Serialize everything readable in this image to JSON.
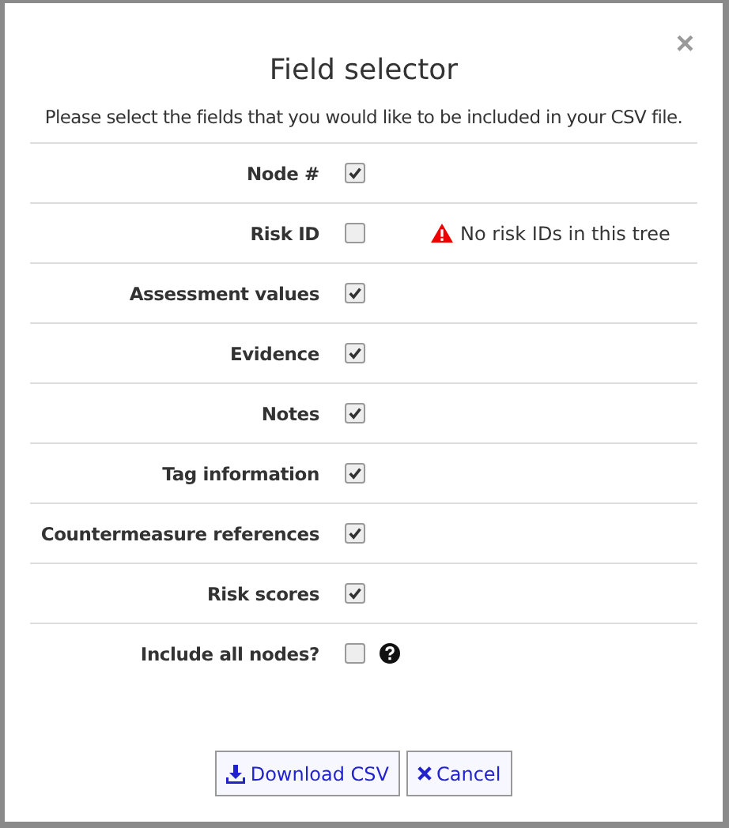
{
  "dialog": {
    "title": "Field selector",
    "close": "×",
    "intro": "Please select the fields that you would like to be included in your CSV file."
  },
  "fields": [
    {
      "label": "Node #",
      "checked": true
    },
    {
      "label": "Risk ID",
      "checked": false,
      "warning": "No risk IDs in this tree"
    },
    {
      "label": "Assessment values",
      "checked": true
    },
    {
      "label": "Evidence",
      "checked": true
    },
    {
      "label": "Notes",
      "checked": true
    },
    {
      "label": "Tag information",
      "checked": true
    },
    {
      "label": "Countermeasure references",
      "checked": true
    },
    {
      "label": "Risk scores",
      "checked": true
    },
    {
      "label": "Include all nodes?",
      "checked": false,
      "help": true
    }
  ],
  "buttons": [
    {
      "kind": "download",
      "label": "Download CSV"
    },
    {
      "kind": "cancel",
      "label": "Cancel"
    }
  ]
}
